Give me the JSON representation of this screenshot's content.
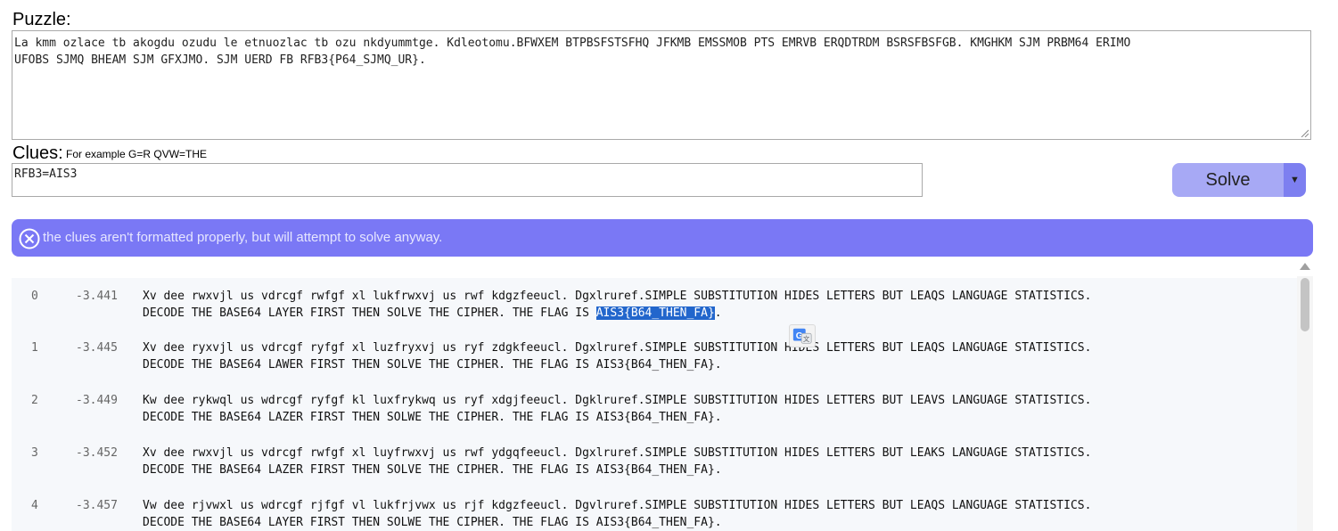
{
  "puzzle": {
    "label": "Puzzle:",
    "text": "La kmm ozlace tb akogdu ozudu le etnuozlac tb ozu nkdyummtge. Kdleotomu.BFWXEM BTPBSFSTSFHQ JFKMB EMSSMOB PTS EMRVB ERQDTRDM BSRSFBSFGB. KMGHKM SJM PRBM64 ERIMO\nUFOBS SJMQ BHEAM SJM GFXJMO. SJM UERD FB RFB3{P64_SJMQ_UR}."
  },
  "clues": {
    "label": "Clues:",
    "hint": "For example G=R QVW=THE",
    "value": "RFB3=AIS3"
  },
  "solve": {
    "label": "Solve",
    "dropdown_glyph": "▼"
  },
  "error": {
    "message": "the clues aren't formatted properly, but will attempt to solve anyway."
  },
  "results": [
    {
      "index": "0",
      "score": "-3.441",
      "line1": "Xv dee rwxvjl us vdrcgf rwfgf xl lukfrwxvj us rwf kdgzfeeucl. Dgxlruref.SIMPLE SUBSTITUTION HIDES LETTERS BUT LEAQS LANGUAGE STATISTICS.",
      "line2_before": "DECODE THE BASE64 LAYER FIRST THEN SOLVE THE CIPHER. THE FLAG IS ",
      "line2_highlight": "AIS3{B64_THEN_FA}",
      "line2_after": "."
    },
    {
      "index": "1",
      "score": "-3.445",
      "line1": "Xv dee ryxvjl us vdrcgf ryfgf xl luzfryxvj us ryf zdgkfeeucl. Dgxlruref.SIMPLE SUBSTITUTION HIDES LETTERS BUT LEAQS LANGUAGE STATISTICS.",
      "line2_before": "DECODE THE BASE64 LAWER FIRST THEN SOLVE THE CIPHER. THE FLAG IS AIS3{B64_THEN_FA}.",
      "line2_highlight": "",
      "line2_after": ""
    },
    {
      "index": "2",
      "score": "-3.449",
      "line1": "Kw dee rykwql us wdrcgf ryfgf kl luxfrykwq us ryf xdgjfeeucl. Dgklruref.SIMPLE SUBSTITUTION HIDES LETTERS BUT LEAVS LANGUAGE STATISTICS.",
      "line2_before": "DECODE THE BASE64 LAZER FIRST THEN SOLWE THE CIPHER. THE FLAG IS AIS3{B64_THEN_FA}.",
      "line2_highlight": "",
      "line2_after": ""
    },
    {
      "index": "3",
      "score": "-3.452",
      "line1": "Xv dee rwxvjl us vdrcgf rwfgf xl luyfrwxvj us rwf ydgqfeeucl. Dgxlruref.SIMPLE SUBSTITUTION HIDES LETTERS BUT LEAKS LANGUAGE STATISTICS.",
      "line2_before": "DECODE THE BASE64 LAZER FIRST THEN SOLVE THE CIPHER. THE FLAG IS AIS3{B64_THEN_FA}.",
      "line2_highlight": "",
      "line2_after": ""
    },
    {
      "index": "4",
      "score": "-3.457",
      "line1": "Vw dee rjvwxl us wdrcgf rjfgf vl lukfrjvwx us rjf kdgzfeeucl. Dgvlruref.SIMPLE SUBSTITUTION HIDES LETTERS BUT LEAQS LANGUAGE STATISTICS.",
      "line2_before": "DECODE THE BASE64 LAYER FIRST THEN SOLWE THE CIPHER. THE FLAG IS AIS3{B64_THEN_FA}.",
      "line2_highlight": "",
      "line2_after": ""
    }
  ],
  "icons": {
    "error": "circle-x-icon",
    "translate": "google-translate-icon",
    "scroll_up": "triangle-up-icon"
  },
  "colors": {
    "banner": "#7a78f5",
    "solve_button": "#a7a9f5",
    "solve_dropdown": "#7d7ff0",
    "highlight": "#2266cc",
    "results_bg": "#f6f8fb"
  }
}
